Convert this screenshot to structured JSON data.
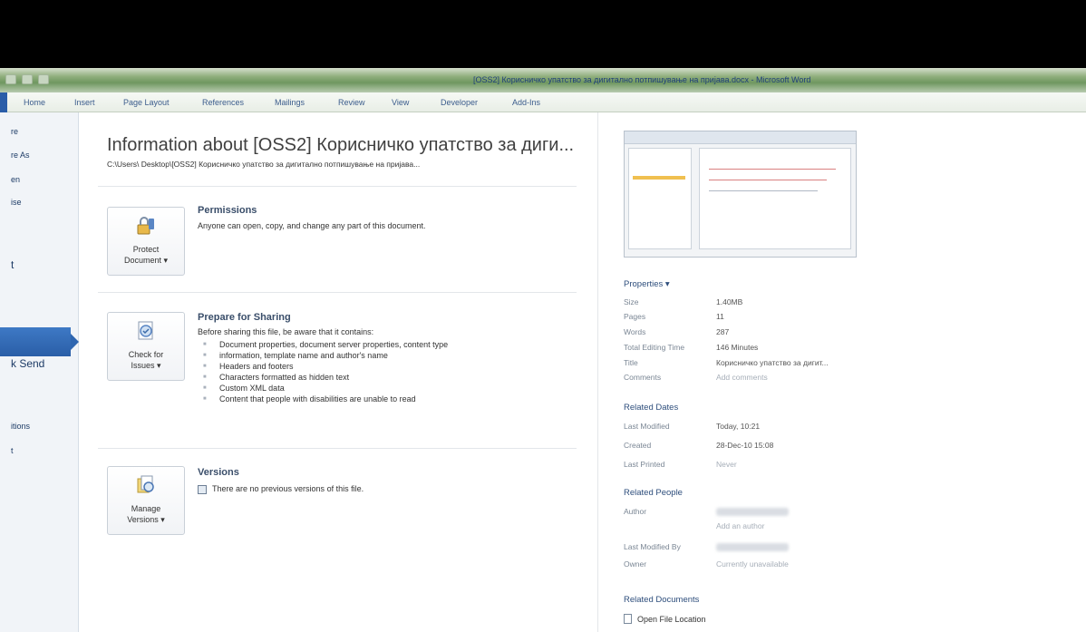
{
  "window": {
    "title": "[OSS2] Корисничко упатство за дигитално потпишување на пријава.docx - Microsoft Word"
  },
  "ribbon_tabs": [
    "Home",
    "Insert",
    "Page Layout",
    "References",
    "Mailings",
    "Review",
    "View",
    "Developer",
    "Add-Ins"
  ],
  "nav": {
    "items": [
      "re",
      "re As",
      "en",
      "ise",
      "t",
      "k Send",
      "itions",
      "t"
    ]
  },
  "info": {
    "title": "Information about [OSS2] Корисничко упатство за диги...",
    "path": "C:\\Users\\          Desktop\\[OSS2] Корисничко упатство за дигитално потпишување на пријава..."
  },
  "permissions": {
    "button_line1": "Protect",
    "button_line2": "Document ▾",
    "title": "Permissions",
    "text": "Anyone can open, copy, and change any part of this document."
  },
  "prepare": {
    "button_line1": "Check for",
    "button_line2": "Issues ▾",
    "title": "Prepare for Sharing",
    "text": "Before sharing this file, be aware that it contains:",
    "bullets": [
      "Document properties, document server properties, content type",
      "Headers and footers",
      "Characters formatted as hidden text",
      "Custom XML data",
      "Content that people with disabilities are unable to read"
    ],
    "bullet_continuation": "information, template name and author's name"
  },
  "versions": {
    "button_line1": "Manage",
    "button_line2": "Versions ▾",
    "title": "Versions",
    "text": "There are no previous versions of this file."
  },
  "properties": {
    "header": "Properties ▾",
    "rows": [
      {
        "label": "Size",
        "value": "1.40MB"
      },
      {
        "label": "Pages",
        "value": "11"
      },
      {
        "label": "Words",
        "value": "287"
      },
      {
        "label": "Total Editing Time",
        "value": "146 Minutes"
      },
      {
        "label": "Title",
        "value": "Корисничко упатство за дигит..."
      },
      {
        "label": "Comments",
        "value": "Add comments"
      }
    ]
  },
  "related_dates": {
    "header": "Related Dates",
    "rows": [
      {
        "label": "Last Modified",
        "value": "Today, 10:21"
      },
      {
        "label": "Created",
        "value": "28-Dec-10 15:08"
      },
      {
        "label": "Last Printed",
        "value": "Never"
      }
    ]
  },
  "related_people": {
    "header": "Related People",
    "author_label": "Author",
    "add_author": "Add an author",
    "last_modified_by_label": "Last Modified By",
    "owner_label": "Owner",
    "owner_value": "Currently unavailable"
  },
  "related_documents": {
    "header": "Related Documents",
    "open_location": "Open File Location"
  }
}
